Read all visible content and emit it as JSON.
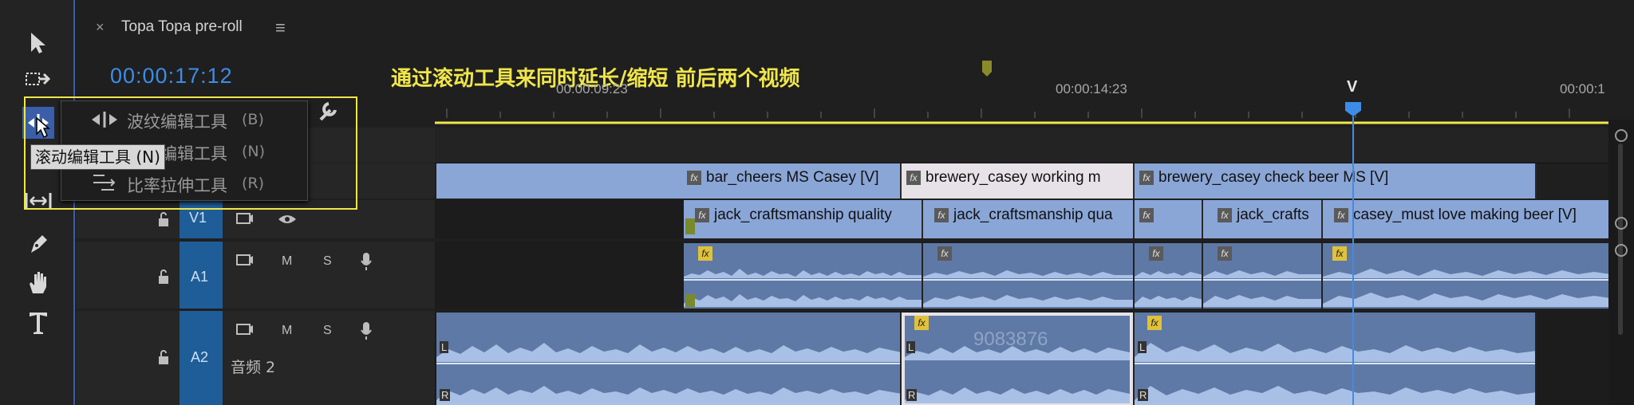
{
  "sequence_tab": {
    "close": "×",
    "title": "Topa Topa pre-roll",
    "menu_icon": "≡"
  },
  "timecode": "00:00:17:12",
  "annotation": "通过滚动工具来同时延长/缩短 前后两个视频",
  "ruler": {
    "labels": [
      "00:00:09:23",
      "00:00:14:23",
      "00:00:1"
    ],
    "playhead_marker": "V"
  },
  "tools": [
    "selection-tool",
    "track-select-tool",
    "ripple-edit-tool",
    "rolling-edit-tool",
    "slip-tool",
    "pen-tool",
    "hand-tool",
    "type-tool"
  ],
  "menu": {
    "items": [
      {
        "label": "波纹编辑工具",
        "shortcut": "(B)"
      },
      {
        "label": "滚动编辑工具",
        "shortcut": "(N)"
      },
      {
        "label": "比率拉伸工具",
        "shortcut": "(R)"
      }
    ],
    "tooltip": "滚动编辑工具 (N)"
  },
  "tracks": {
    "v1": {
      "name": "V1"
    },
    "a1": {
      "name": "A1",
      "m": "M",
      "s": "S"
    },
    "a2": {
      "name": "A2",
      "m": "M",
      "s": "S",
      "label": "音频 2"
    }
  },
  "clips": {
    "v2": [
      {
        "name": "bar_cheers MS Casey [V]"
      },
      {
        "name": "brewery_casey working m"
      },
      {
        "name": "brewery_casey check beer MS [V]"
      }
    ],
    "v1": [
      {
        "name": "jack_craftsmanship quality"
      },
      {
        "name": "jack_craftsmanship qua"
      },
      {
        "name": ""
      },
      {
        "name": "jack_crafts"
      },
      {
        "name": "casey_must love making beer [V]"
      }
    ]
  },
  "watermark": "9083876",
  "fx_label": "fx",
  "channel_labels": {
    "left": "L",
    "right": "R"
  },
  "colors": {
    "timecode": "#3d8de8",
    "annotation": "#f0e64a",
    "clip_video": "#8aa6d7",
    "clip_audio": "#5e79a6",
    "track_selected": "#1f5d99",
    "playhead": "#3d8de8"
  }
}
